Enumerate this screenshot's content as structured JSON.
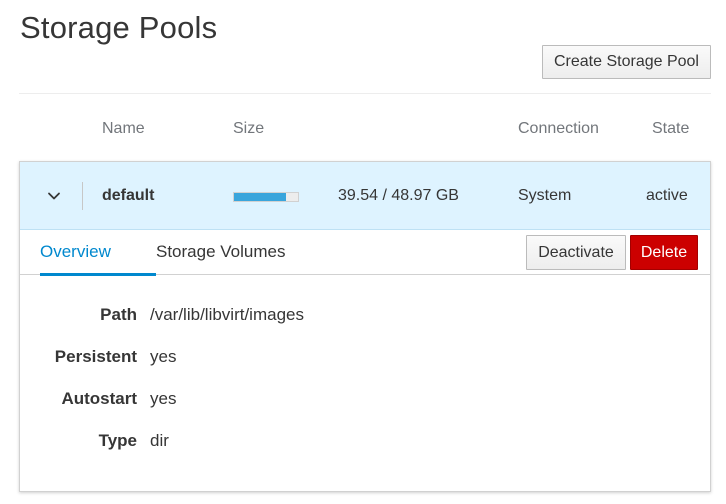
{
  "page": {
    "title": "Storage Pools",
    "create_button": "Create Storage Pool"
  },
  "table": {
    "headers": {
      "name": "Name",
      "size": "Size",
      "connection": "Connection",
      "state": "State"
    },
    "pool": {
      "name": "default",
      "usage_fraction": 0.81,
      "size": "39.54 / 48.97 GB",
      "connection": "System",
      "state": "active"
    }
  },
  "tabs": [
    {
      "label": "Overview",
      "active": true
    },
    {
      "label": "Storage Volumes",
      "active": false
    }
  ],
  "actions": {
    "deactivate": "Deactivate",
    "delete": "Delete"
  },
  "details": [
    {
      "label": "Path",
      "value": "/var/lib/libvirt/images"
    },
    {
      "label": "Persistent",
      "value": "yes"
    },
    {
      "label": "Autostart",
      "value": "yes"
    },
    {
      "label": "Type",
      "value": "dir"
    }
  ],
  "colors": {
    "accent": "#0088ce",
    "row_highlight": "#def3ff",
    "progress": "#39a5dc",
    "danger": "#cc0000"
  }
}
